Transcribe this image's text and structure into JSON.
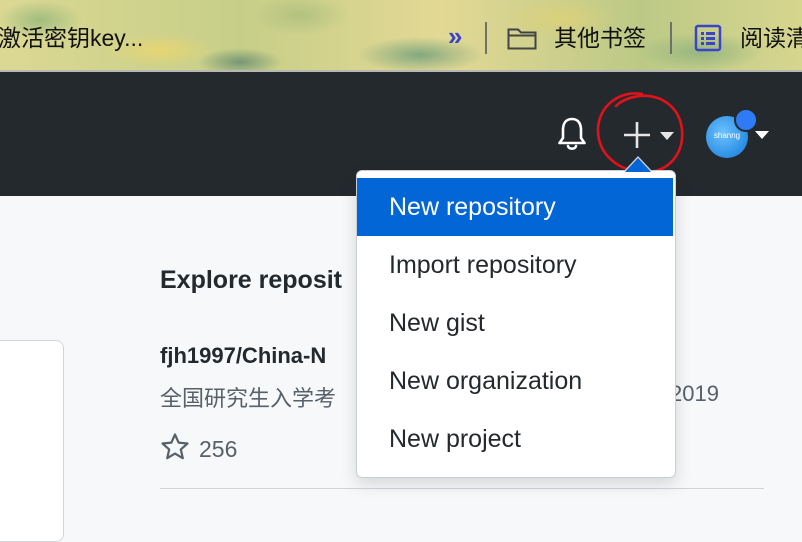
{
  "bookmarks": {
    "item1": "激活密钥key...",
    "overflow_chevron": "»",
    "folder_label": "其他书签",
    "reader_label": "阅读清"
  },
  "header": {
    "avatar_text": "shanng"
  },
  "menu": {
    "items": [
      "New repository",
      "Import repository",
      "New gist",
      "New organization",
      "New project"
    ],
    "active_index": 0,
    "active_color": "#0366d6"
  },
  "content": {
    "heading": "Explore reposit",
    "repo_name": "fjh1997/China-N",
    "repo_desc": "全国研究生入学考",
    "repo_year": "2019",
    "stars": "256"
  },
  "colors": {
    "header_bg": "#24292e",
    "annotation": "#e0131a"
  }
}
